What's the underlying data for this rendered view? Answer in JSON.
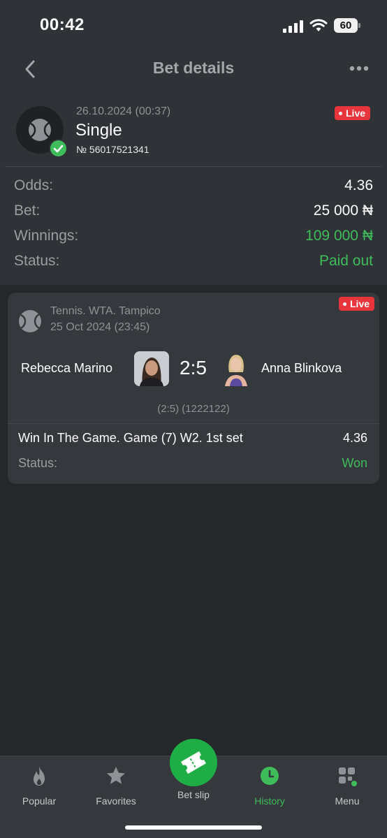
{
  "status_bar": {
    "time": "00:42",
    "battery": "60"
  },
  "header": {
    "title": "Bet details"
  },
  "bet": {
    "date": "26.10.2024 (00:37)",
    "type": "Single",
    "number": "№ 56017521341",
    "live": "Live"
  },
  "summary": [
    {
      "label": "Odds:",
      "value": "4.36"
    },
    {
      "label": "Bet:",
      "value": "25 000 ₦"
    },
    {
      "label": "Winnings:",
      "value": "109 000 ₦"
    },
    {
      "label": "Status:",
      "value": "Paid out"
    }
  ],
  "event": {
    "league": "Tennis. WTA. Tampico",
    "date": "25 Oct 2024 (23:45)",
    "live": "Live",
    "player1": "Rebecca Marino",
    "player2": "Anna Blinkova",
    "score": "2:5",
    "score_detail": "(2:5) (1222122)",
    "market": "Win In The Game. Game (7) W2. 1st set",
    "odds": "4.36",
    "status_label": "Status:",
    "status_value": "Won"
  },
  "nav": {
    "popular": "Popular",
    "favorites": "Favorites",
    "bet_slip": "Bet slip",
    "history": "History",
    "menu": "Menu"
  },
  "colors": {
    "accent_green": "#3ebd5a",
    "live_red": "#e8353b",
    "background": "#25282b",
    "card": "#35383c"
  }
}
